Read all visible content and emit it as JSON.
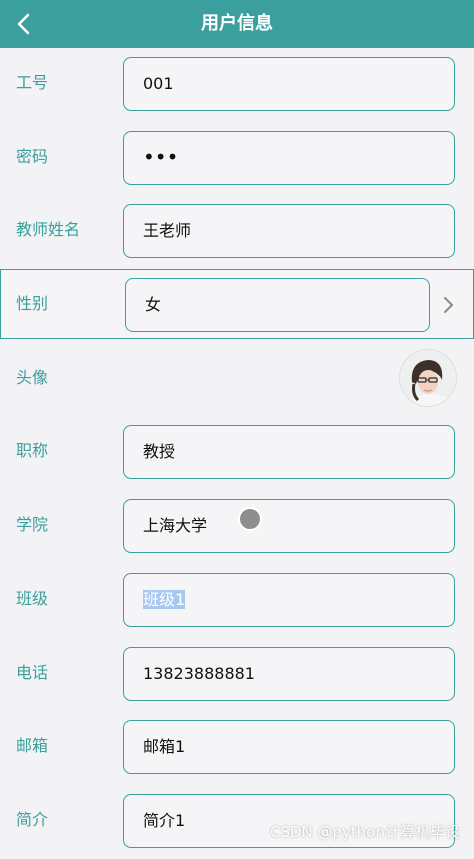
{
  "header": {
    "title": "用户信息",
    "back_icon": "chevron-left-icon"
  },
  "form": {
    "employee_id": {
      "label": "工号",
      "value": "001"
    },
    "password": {
      "label": "密码",
      "value": "•••"
    },
    "teacher_name": {
      "label": "教师姓名",
      "value": "王老师"
    },
    "gender": {
      "label": "性别",
      "value": "女",
      "chevron_icon": "chevron-right-icon"
    },
    "avatar": {
      "label": "头像"
    },
    "title_rank": {
      "label": "职称",
      "value": "教授"
    },
    "college": {
      "label": "学院",
      "value": "上海大学"
    },
    "class": {
      "label": "班级",
      "value": "班级1"
    },
    "phone": {
      "label": "电话",
      "value": "13823888881"
    },
    "email": {
      "label": "邮箱",
      "value": "邮箱1"
    },
    "intro": {
      "label": "简介",
      "value": "简介1"
    }
  },
  "watermark": "CSDN @python计算机毕设",
  "colors": {
    "accent": "#3a9f9d",
    "background": "#f3f3f5",
    "selection": "#a9c8f0"
  }
}
